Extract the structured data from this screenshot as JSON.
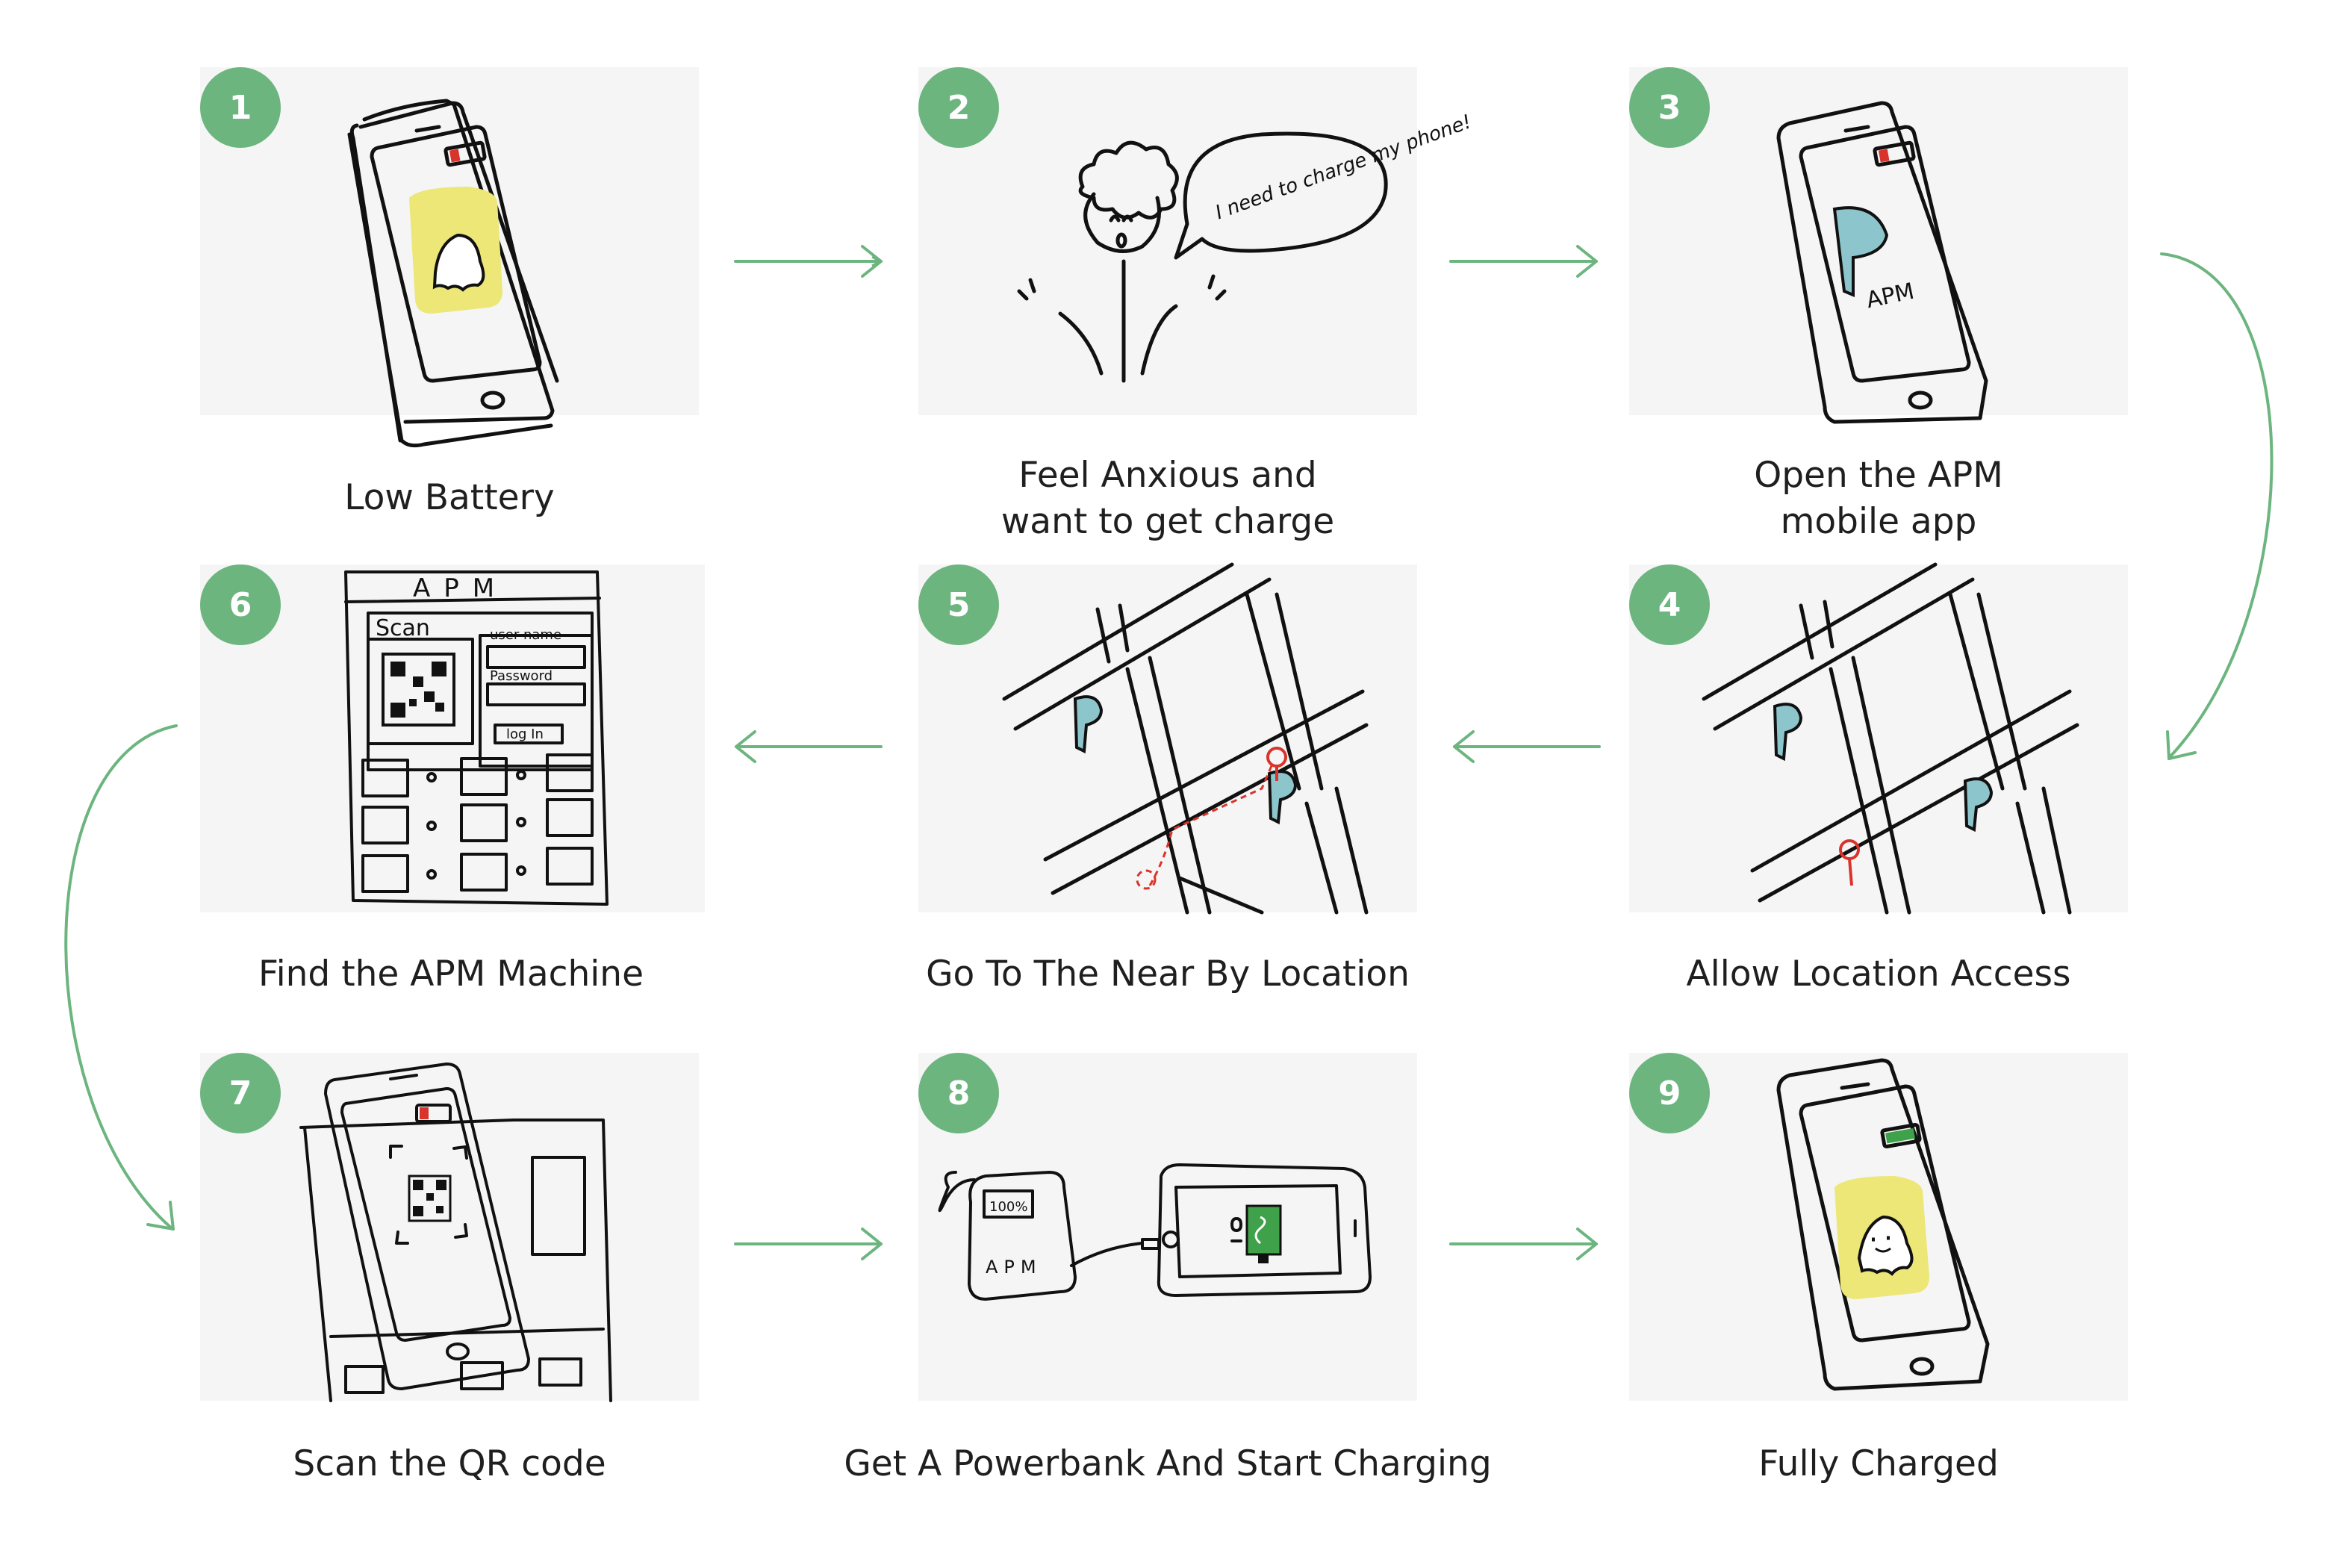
{
  "colors": {
    "accent": "#6cb57f",
    "panel": "#f5f5f5",
    "text": "#1f1f1f",
    "sketch_yellow": "#ece776",
    "sketch_teal": "#8cc6cc",
    "sketch_red": "#d9342b"
  },
  "steps": [
    {
      "number": "1",
      "caption": "Low Battery"
    },
    {
      "number": "2",
      "caption": "Feel Anxious and\nwant to get charge"
    },
    {
      "number": "3",
      "caption": "Open the APM\nmobile app"
    },
    {
      "number": "4",
      "caption": "Allow Location Access"
    },
    {
      "number": "5",
      "caption": "Go To The Near By Location"
    },
    {
      "number": "6",
      "caption": "Find the APM Machine"
    },
    {
      "number": "7",
      "caption": "Scan the QR code"
    },
    {
      "number": "8",
      "caption": "Get A Powerbank And Start Charging"
    },
    {
      "number": "9",
      "caption": "Fully Charged"
    }
  ],
  "sketch_text": {
    "speech": "I need to charge my phone!",
    "apm": "APM",
    "scan": "Scan",
    "username": "user name",
    "password": "Password",
    "login": "log In",
    "percent": "100%"
  }
}
